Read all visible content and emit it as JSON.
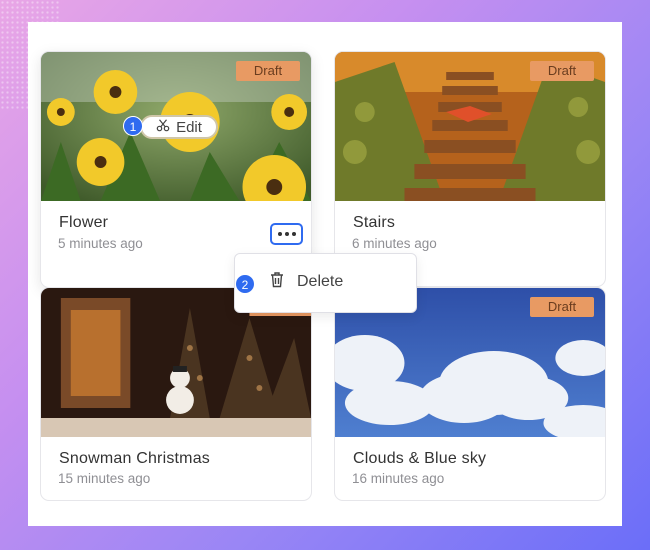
{
  "cards": [
    {
      "title": "Flower",
      "time": "5 minutes ago",
      "badge": "Draft"
    },
    {
      "title": "Stairs",
      "time": "6 minutes ago",
      "badge": "Draft"
    },
    {
      "title": "Snowman Christmas",
      "time": "15 minutes ago",
      "badge": ""
    },
    {
      "title": "Clouds & Blue sky",
      "time": "16 minutes ago",
      "badge": "Draft"
    }
  ],
  "edit_button": {
    "label": "Edit",
    "step": "1"
  },
  "menu": {
    "delete_label": "Delete",
    "step": "2"
  },
  "colors": {
    "accent": "#2f6bf0",
    "badge_bg": "#e89a63"
  },
  "icons": {
    "edit": "scissors-icon",
    "delete": "trash-icon",
    "more": "more-dots-icon"
  }
}
